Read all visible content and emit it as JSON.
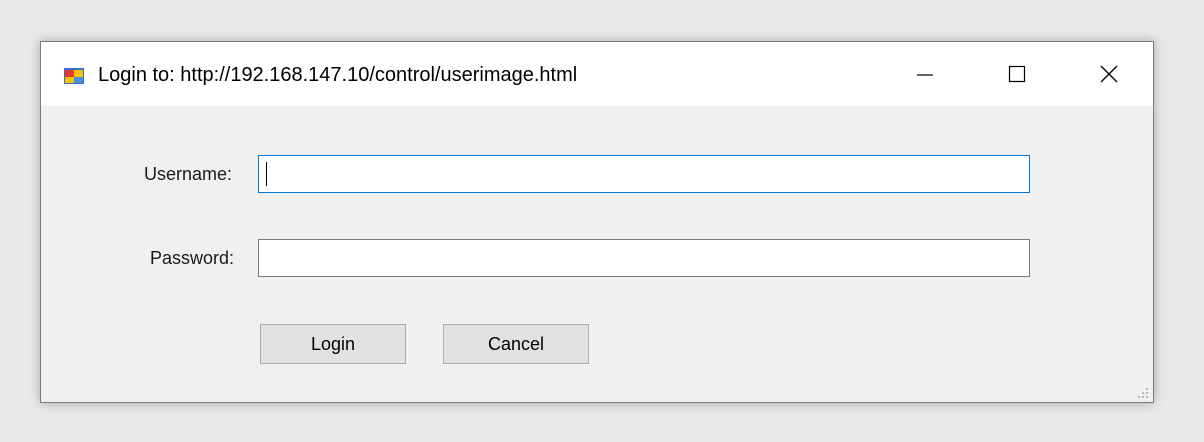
{
  "window": {
    "title": "Login to: http://192.168.147.10/control/userimage.html",
    "icon": "app-window-icon",
    "controls": {
      "minimize": "minimize-icon",
      "maximize": "maximize-icon",
      "close": "close-icon"
    }
  },
  "form": {
    "username_label": "Username:",
    "username_value": "",
    "password_label": "Password:",
    "password_value": "",
    "login_label": "Login",
    "cancel_label": "Cancel"
  },
  "colors": {
    "focus_border": "#0078d7",
    "window_bg": "#f0f0f0",
    "button_bg": "#e1e1e1"
  }
}
